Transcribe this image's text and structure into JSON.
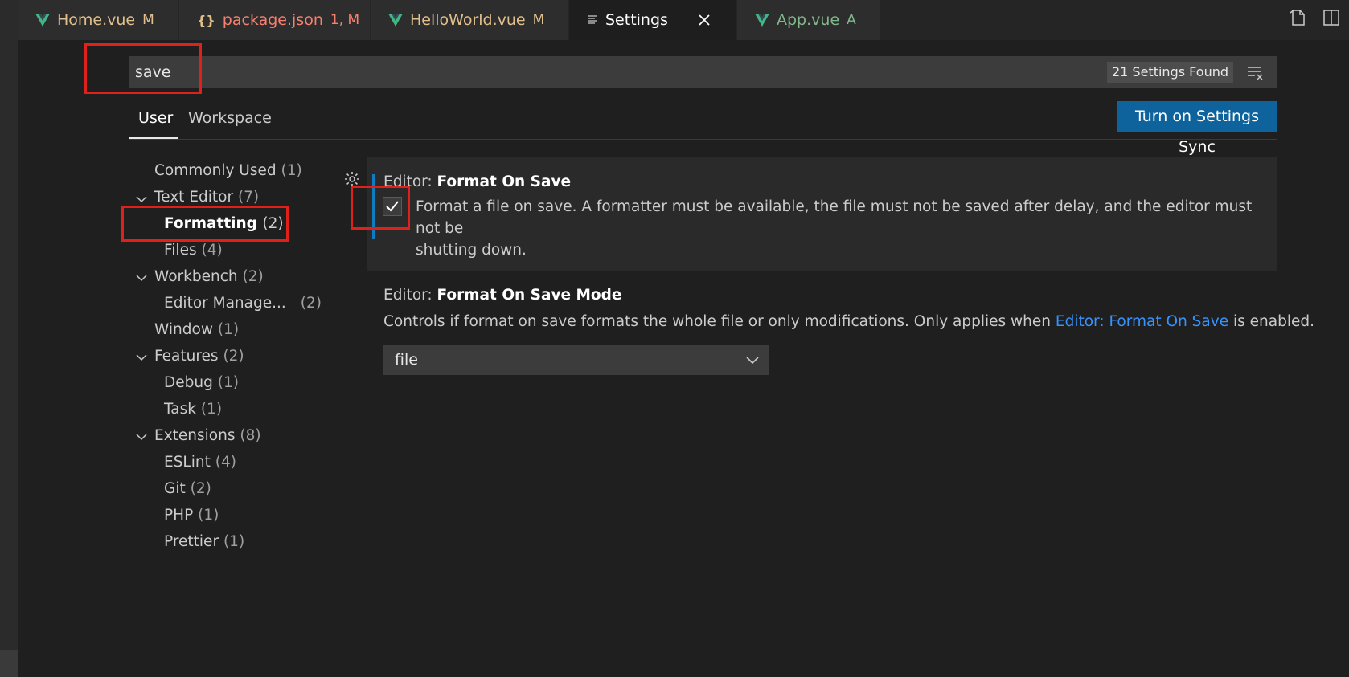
{
  "tabs": [
    {
      "label": "Home.vue",
      "status": "M",
      "color": "#e2c08d",
      "icon": "vue-icon"
    },
    {
      "label": "package.json",
      "status": "1, M",
      "color": "#f88070",
      "icon": "json-braces-icon"
    },
    {
      "label": "HelloWorld.vue",
      "status": "M",
      "color": "#e2c08d",
      "icon": "vue-icon"
    },
    {
      "label": "Settings",
      "status": "",
      "color": "#ffffff",
      "icon": "settings-list-icon"
    },
    {
      "label": "App.vue",
      "status": "A",
      "color": "#81b88b",
      "icon": "vue-icon"
    }
  ],
  "search": {
    "value": "save",
    "result_count": "21 Settings Found"
  },
  "scope_tabs": {
    "user": "User",
    "workspace": "Workspace"
  },
  "sync_button": "Turn on Settings Sync",
  "toc": [
    {
      "label": "Commonly Used",
      "count": "(1)"
    },
    {
      "label": "Text Editor",
      "count": "(7)"
    },
    {
      "label": "Formatting",
      "count": "(2)"
    },
    {
      "label": "Files",
      "count": "(4)"
    },
    {
      "label": "Workbench",
      "count": "(2)"
    },
    {
      "label": "Editor Manage...",
      "count": "(2)"
    },
    {
      "label": "Window",
      "count": "(1)"
    },
    {
      "label": "Features",
      "count": "(2)"
    },
    {
      "label": "Debug",
      "count": "(1)"
    },
    {
      "label": "Task",
      "count": "(1)"
    },
    {
      "label": "Extensions",
      "count": "(8)"
    },
    {
      "label": "ESLint",
      "count": "(4)"
    },
    {
      "label": "Git",
      "count": "(2)"
    },
    {
      "label": "PHP",
      "count": "(1)"
    },
    {
      "label": "Prettier",
      "count": "(1)"
    }
  ],
  "settings": [
    {
      "category": "Editor: ",
      "name": "Format On Save",
      "description_line1": "Format a file on save. A formatter must be available, the file must not be saved after delay, and the editor must not be",
      "description_line2": "shutting down.",
      "checked": true
    },
    {
      "category": "Editor: ",
      "name": "Format On Save Mode",
      "description_before": "Controls if format on save formats the whole file or only modifications. Only applies when ",
      "description_link": "Editor: Format On Save",
      "description_after": " is enabled.",
      "selected_value": "file"
    }
  ],
  "colors": {
    "accent": "#0e639c",
    "link": "#3794ff",
    "annotation": "#e0201a"
  }
}
